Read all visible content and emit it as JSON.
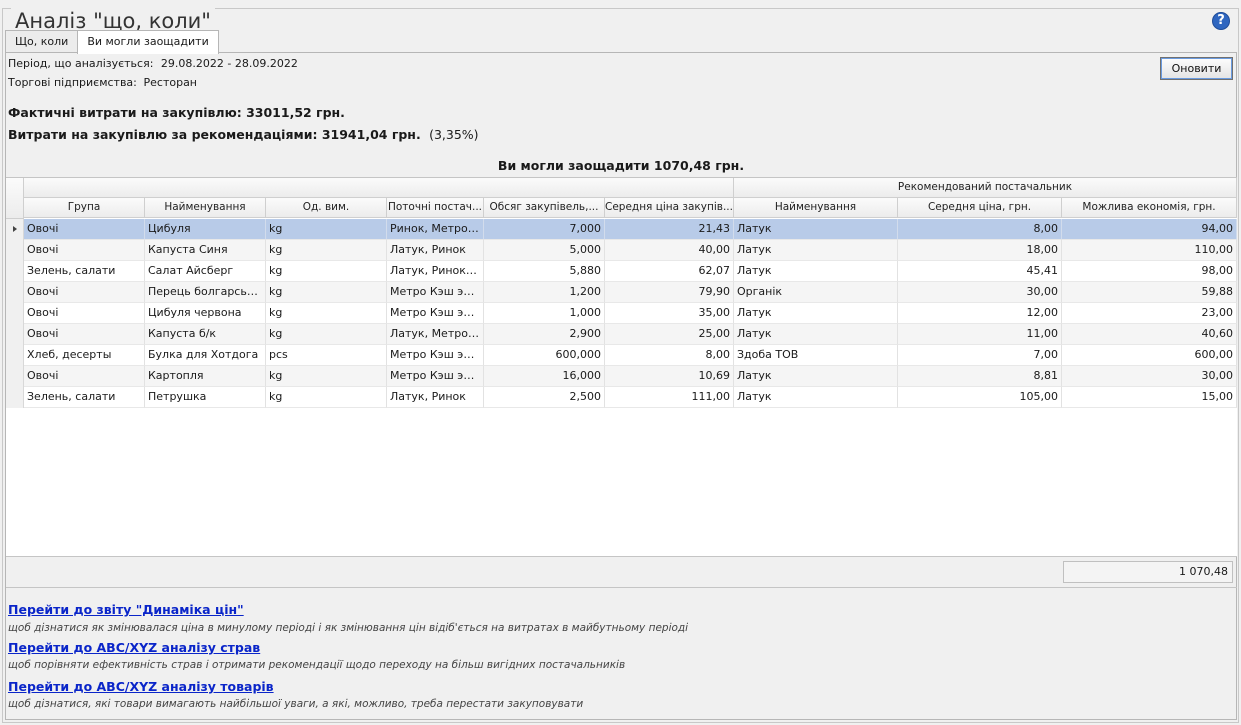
{
  "window": {
    "title": "Аналіз \"що, коли\""
  },
  "tabs": [
    {
      "label": "Що, коли",
      "active": false
    },
    {
      "label": "Ви могли заощадити",
      "active": true
    }
  ],
  "info": {
    "period_label": "Період, що аналізується:",
    "period_value": "29.08.2022 - 28.09.2022",
    "enterprise_label": "Торгові підприємства:",
    "enterprise_value": "Ресторан"
  },
  "toolbar": {
    "update_label": "Оновити"
  },
  "summary": {
    "actual_label": "Фактичні витрати на закупівлю:",
    "actual_value": "33011,52 грн.",
    "recommended_label": "Витрати на закупівлю за рекомендаціями:",
    "recommended_value": "31941,04 грн.",
    "recommended_pct": "(3,35%)",
    "savings_label": "Ви могли заощадити",
    "savings_value": "1070,48 грн."
  },
  "grid": {
    "group_header": "Рекомендований постачальник",
    "columns": [
      "Група",
      "Найменування",
      "Од. вим.",
      "Поточні постачальники",
      "Обсяг закупівель, од.",
      "Середня ціна закупівлі",
      "Найменування",
      "Середня ціна, грн.",
      "Можлива економія, грн."
    ],
    "column_headers_display": [
      "Група",
      "Найменування",
      "Од. вим.",
      "Поточні постач...",
      "Обсяг закупівель,...",
      "Середня ціна закупів...",
      "Найменування",
      "Середня ціна, грн.",
      "Можлива економія, грн."
    ],
    "rows": [
      [
        "Овочі",
        "Цибуля",
        "kg",
        "Ринок, Метро ...",
        "7,000",
        "21,43",
        "Латук",
        "8,00",
        "94,00"
      ],
      [
        "Овочі",
        "Капуста Синя",
        "kg",
        "Латук, Ринок",
        "5,000",
        "40,00",
        "Латук",
        "18,00",
        "110,00"
      ],
      [
        "Зелень, салати",
        "Салат Айсберг",
        "kg",
        "Латук, Ринок, ...",
        "5,880",
        "62,07",
        "Латук",
        "45,41",
        "98,00"
      ],
      [
        "Овочі",
        "Перець болгарський",
        "kg",
        "Метро Кэш энд...",
        "1,200",
        "79,90",
        "Органік",
        "30,00",
        "59,88"
      ],
      [
        "Овочі",
        "Цибуля червона",
        "kg",
        "Метро Кэш энд...",
        "1,000",
        "35,00",
        "Латук",
        "12,00",
        "23,00"
      ],
      [
        "Овочі",
        "Капуста б/к",
        "kg",
        "Латук, Метро ...",
        "2,900",
        "25,00",
        "Латук",
        "11,00",
        "40,60"
      ],
      [
        "Хлеб, десерты",
        "Булка для Хотдога",
        "pcs",
        "Метро Кэш энд...",
        "600,000",
        "8,00",
        "Здоба ТОВ",
        "7,00",
        "600,00"
      ],
      [
        "Овочі",
        "Картопля",
        "kg",
        "Метро Кэш энд...",
        "16,000",
        "10,69",
        "Латук",
        "8,81",
        "30,00"
      ],
      [
        "Зелень, салати",
        "Петрушка",
        "kg",
        "Латук, Ринок",
        "2,500",
        "111,00",
        "Латук",
        "105,00",
        "15,00"
      ]
    ],
    "selected_row": 0,
    "total": "1 070,48"
  },
  "links": [
    {
      "label": "Перейти до звіту \"Динаміка цін\"",
      "hint": "щоб дізнатися як змінювалася ціна в минулому періоді і як змінювання цін відіб'ється на витратах в майбутньому періоді"
    },
    {
      "label": "Перейти до ABC/XYZ аналізу страв",
      "hint": "щоб порівняти ефективність страв і отримати рекомендації щодо переходу на більш вигідних постачальників"
    },
    {
      "label": "Перейти до ABC/XYZ аналізу товарів",
      "hint": "щоб дізнатися, які товари вимагають найбільшої уваги, а які, можливо, треба перестати закуповувати"
    }
  ],
  "colors": {
    "selection": "#b8cbe8",
    "link": "#0a25c9"
  }
}
